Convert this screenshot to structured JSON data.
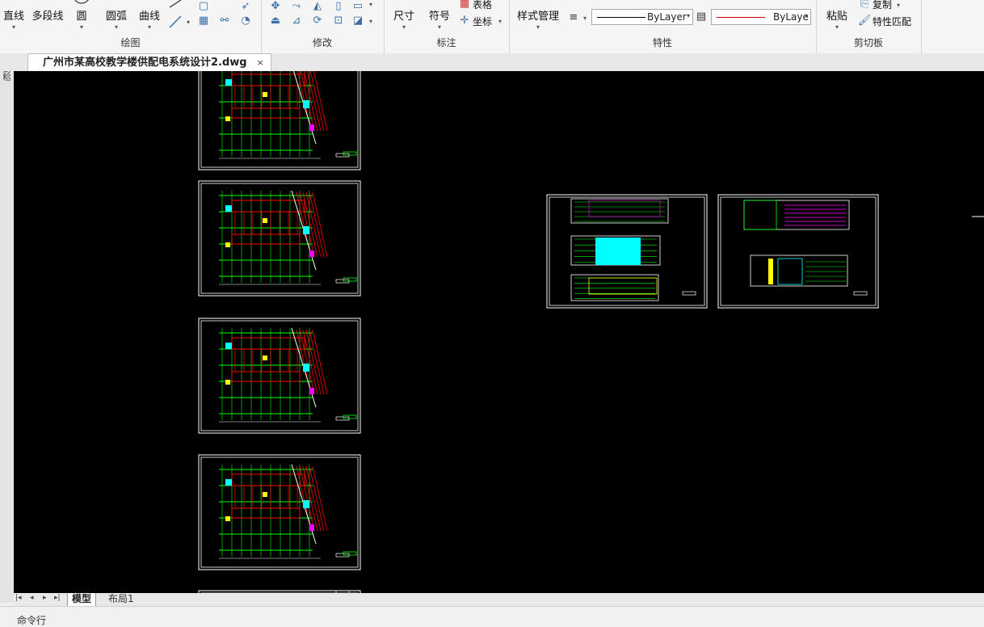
{
  "ribbon": {
    "draw": {
      "title": "绘图",
      "line": "直线",
      "polyline": "多段线",
      "circle": "圆",
      "arc": "圆弧",
      "curve": "曲线"
    },
    "modify": {
      "title": "修改"
    },
    "annotate": {
      "title": "标注",
      "dimension": "尺寸",
      "symbol": "符号",
      "table": "表格",
      "coordinate": "坐标"
    },
    "properties": {
      "title": "特性",
      "style_manager": "样式管理",
      "linetype": "ByLayer",
      "lineweight": "ByLaye"
    },
    "clipboard": {
      "title": "剪切板",
      "paste": "粘贴",
      "copy": "复制",
      "match": "特性匹配"
    }
  },
  "document": {
    "tab_title": "广州市某高校教学楼供配电系统设计2.dwg",
    "close": "×"
  },
  "left_strip": {
    "text": "宜 劉 粭"
  },
  "layout_tabs": {
    "model": "模型",
    "layout1": "布局1"
  },
  "nav": {
    "first": "|◂",
    "prev": "◂",
    "next": "▸",
    "last": "▸|"
  },
  "command_line": {
    "label": "命令行"
  },
  "colors": {
    "canvas": "#000000",
    "green": "#00ff00",
    "cyan": "#00ffff",
    "red": "#ff0000",
    "yellow": "#ffff00",
    "magenta": "#ff00ff",
    "white": "#ffffff"
  }
}
